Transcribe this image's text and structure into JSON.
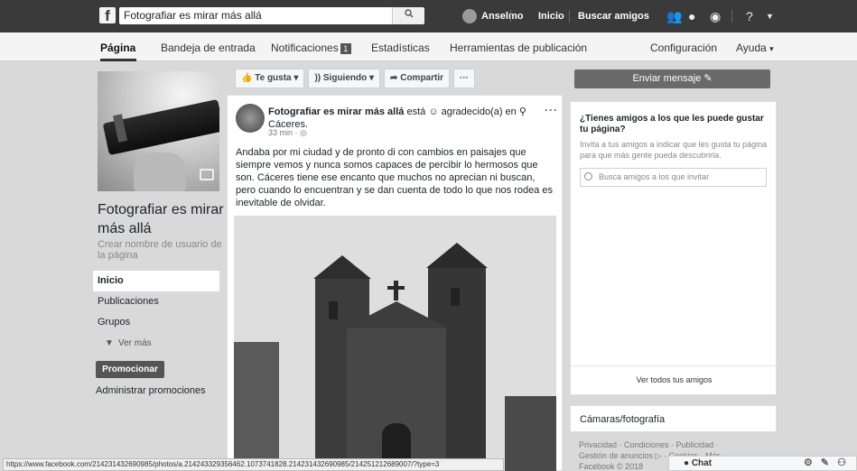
{
  "topbar": {
    "logo": "f",
    "search_value": "Fotografiar es mirar más allá",
    "search_icon": "search-icon",
    "user_name": "Anselmo",
    "home_link": "Inicio",
    "find_friends": "Buscar amigos"
  },
  "tabs": {
    "page": "Página",
    "inbox": "Bandeja de entrada",
    "notifications": "Notificaciones",
    "notifications_badge": "1",
    "stats": "Estadísticas",
    "publishing_tools": "Herramientas de publicación",
    "settings": "Configuración",
    "help": "Ayuda"
  },
  "left": {
    "page_name": "Fotografiar es mirar más allá",
    "create_username": "Crear nombre de usuario de la página",
    "nav": [
      "Inicio",
      "Publicaciones",
      "Grupos"
    ],
    "more": "Ver más",
    "promote": "Promocionar",
    "manage_promotions": "Administrar promociones"
  },
  "actions": {
    "like": "Te gusta",
    "following": "Siguiendo",
    "share": "Compartir",
    "more": "···"
  },
  "post": {
    "author": "Fotografiar es mirar más allá",
    "feeling": "está",
    "feeling_text": "agradecido(a) en",
    "location": "Cáceres.",
    "time": "33 min",
    "text": "Andaba por mi ciudad y de pronto di con cambios en paisajes que siempre vemos y nunca somos capaces de percibir lo hermosos que son. Cáceres tiene ese encanto que muchos no aprecian ni buscan, pero cuando lo encuentran y se dan cuenta de todo lo que nos rodea es inevitable de olvidar."
  },
  "right": {
    "send_message": "Enviar mensaje",
    "invite_title": "¿Tienes amigos a los que les puede gustar tu página?",
    "invite_sub": "Invita a tus amigos a indicar que les gusta tu página para que más gente pueda descubrirla.",
    "search_placeholder": "Busca amigos a los que invitar",
    "see_all": "Ver todos tus amigos",
    "category": "Cámaras/fotografía",
    "footer": "Privacidad · Condiciones · Publicidad · Gestión de anuncios ▷ · Cookies · Más · Facebook © 2018"
  },
  "statusbar": {
    "url": "https://www.facebook.com/214231432690985/photos/a.214243329356462.1073741828.214231432690985/214251212689007/?type=3"
  },
  "chat": {
    "label": "● Chat",
    "icons": "⚙ ✎ ⚇"
  }
}
